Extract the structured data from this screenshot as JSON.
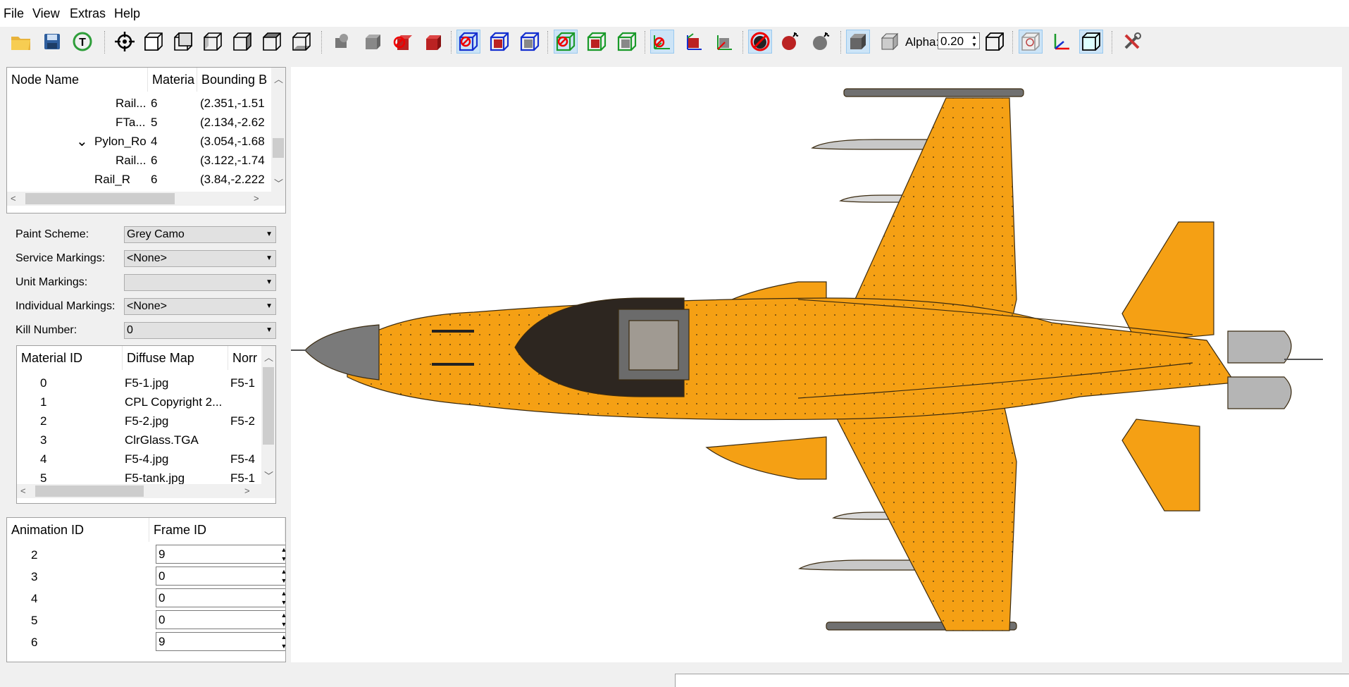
{
  "menu": [
    "File",
    "View",
    "Extras",
    "Help"
  ],
  "toolbar": {
    "alpha_label": "Alpha:",
    "alpha_value": "0.20",
    "icons": [
      "open-folder-icon",
      "save-icon",
      "reload-texture-icon",
      "center-view-icon",
      "view-front-icon",
      "view-back-icon",
      "view-left-icon",
      "view-right-icon",
      "view-top-icon",
      "view-bottom-icon",
      "hide-gray-icon",
      "show-gray-icon",
      "hide-red-icon",
      "show-red-icon",
      "toggle-blue-wire-icon",
      "toggle-blue-solid-icon",
      "toggle-blue-gray-icon",
      "toggle-green-wire-icon",
      "toggle-green-solid-icon",
      "toggle-green-gray-icon",
      "axes-red-icon",
      "axes-box-icon",
      "axes-green-icon",
      "no-bomb-icon",
      "bomb-icon",
      "bomb-gray-icon",
      "solid-shading-icon",
      "transparent-shading-icon",
      "wireframe-icon",
      "bounding-box-icon",
      "axes-icon",
      "cube-outline-icon",
      "settings-tools-icon"
    ]
  },
  "node_tree": {
    "headers": [
      "Node Name",
      "Materia",
      "Bounding B"
    ],
    "rows": [
      {
        "name": "Rail...",
        "material": "6",
        "bbox": "(2.351,-1.51",
        "expander": ""
      },
      {
        "name": "FTa...",
        "material": "5",
        "bbox": "(2.134,-2.62",
        "expander": ""
      },
      {
        "name": "Pylon_Ro",
        "material": "4",
        "bbox": "(3.054,-1.68",
        "expander": "⌄"
      },
      {
        "name": "Rail...",
        "material": "6",
        "bbox": "(3.122,-1.74",
        "expander": ""
      },
      {
        "name": "Rail_R",
        "material": "6",
        "bbox": "(3.84,-2.222",
        "expander": ""
      }
    ]
  },
  "form": {
    "paint_scheme": {
      "label": "Paint Scheme:",
      "value": "Grey Camo"
    },
    "service_markings": {
      "label": "Service Markings:",
      "value": "<None>"
    },
    "unit_markings": {
      "label": "Unit Markings:",
      "value": ""
    },
    "individual_markings": {
      "label": "Individual Markings:",
      "value": "<None>"
    },
    "kill_number": {
      "label": "Kill Number:",
      "value": "0"
    }
  },
  "materials": {
    "headers": [
      "Material ID",
      "Diffuse Map",
      "Norr"
    ],
    "rows": [
      {
        "id": "0",
        "diffuse": "F5-1.jpg",
        "normal": "F5-1"
      },
      {
        "id": "1",
        "diffuse": "CPL Copyright 2...",
        "normal": ""
      },
      {
        "id": "2",
        "diffuse": "F5-2.jpg",
        "normal": "F5-2"
      },
      {
        "id": "3",
        "diffuse": "ClrGlass.TGA",
        "normal": ""
      },
      {
        "id": "4",
        "diffuse": "F5-4.jpg",
        "normal": "F5-4"
      },
      {
        "id": "5",
        "diffuse": "F5-tank.jpg",
        "normal": "F5-1"
      }
    ]
  },
  "animations": {
    "headers": [
      "Animation ID",
      "Frame ID"
    ],
    "rows": [
      {
        "id": "2",
        "frame": "9"
      },
      {
        "id": "3",
        "frame": "0"
      },
      {
        "id": "4",
        "frame": "0"
      },
      {
        "id": "5",
        "frame": "0"
      },
      {
        "id": "6",
        "frame": "9"
      }
    ]
  },
  "colors": {
    "airframe": "#f5a014",
    "accent_blue": "#0078d7",
    "panel_border": "#a0a0a0"
  }
}
